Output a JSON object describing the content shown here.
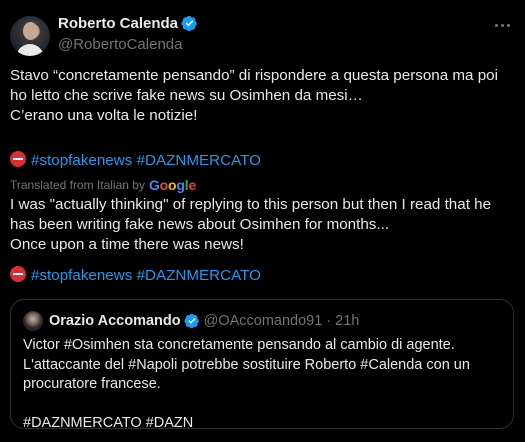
{
  "author": {
    "name": "Roberto Calenda",
    "handle": "@RobertoCalenda"
  },
  "tweet": {
    "original_text": "Stavo “concretamente pensando” di rispondere a questa persona ma poi ho letto che scrive fake news su Osimhen da mesi…\nC’erano una volta le notizie!",
    "original_hashtags": [
      "#stopfakenews",
      "#DAZNMERCATO"
    ],
    "translated_label": "Translated from Italian by",
    "translator": "Google",
    "translated_text": "I was \"actually thinking\" of replying to this person but then I read that he has been writing fake news about Osimhen for months...\nOnce upon a time there was news!",
    "translated_hashtags": [
      "#stopfakenews",
      "#DAZNMERCATO"
    ]
  },
  "quoted": {
    "name": "Orazio Accomando",
    "handle": "@OAccomando91",
    "separator": "·",
    "time": "21h",
    "text": "Victor #Osimhen sta concretamente pensando al cambio di agente.\nL'attaccante del #Napoli potrebbe sostituire Roberto #Calenda con un procuratore francese.\n\n#DAZNMERCATO #DAZN"
  },
  "colors": {
    "background": "#000000",
    "text": "#e7e9ea",
    "secondary": "#71767b",
    "link": "#1d9bf0",
    "verified": "#1d9bf0",
    "noentry": "#db2d35"
  },
  "icons": [
    "verified-badge-icon",
    "more-options-icon",
    "no-entry-emoji-icon",
    "google-logo"
  ]
}
